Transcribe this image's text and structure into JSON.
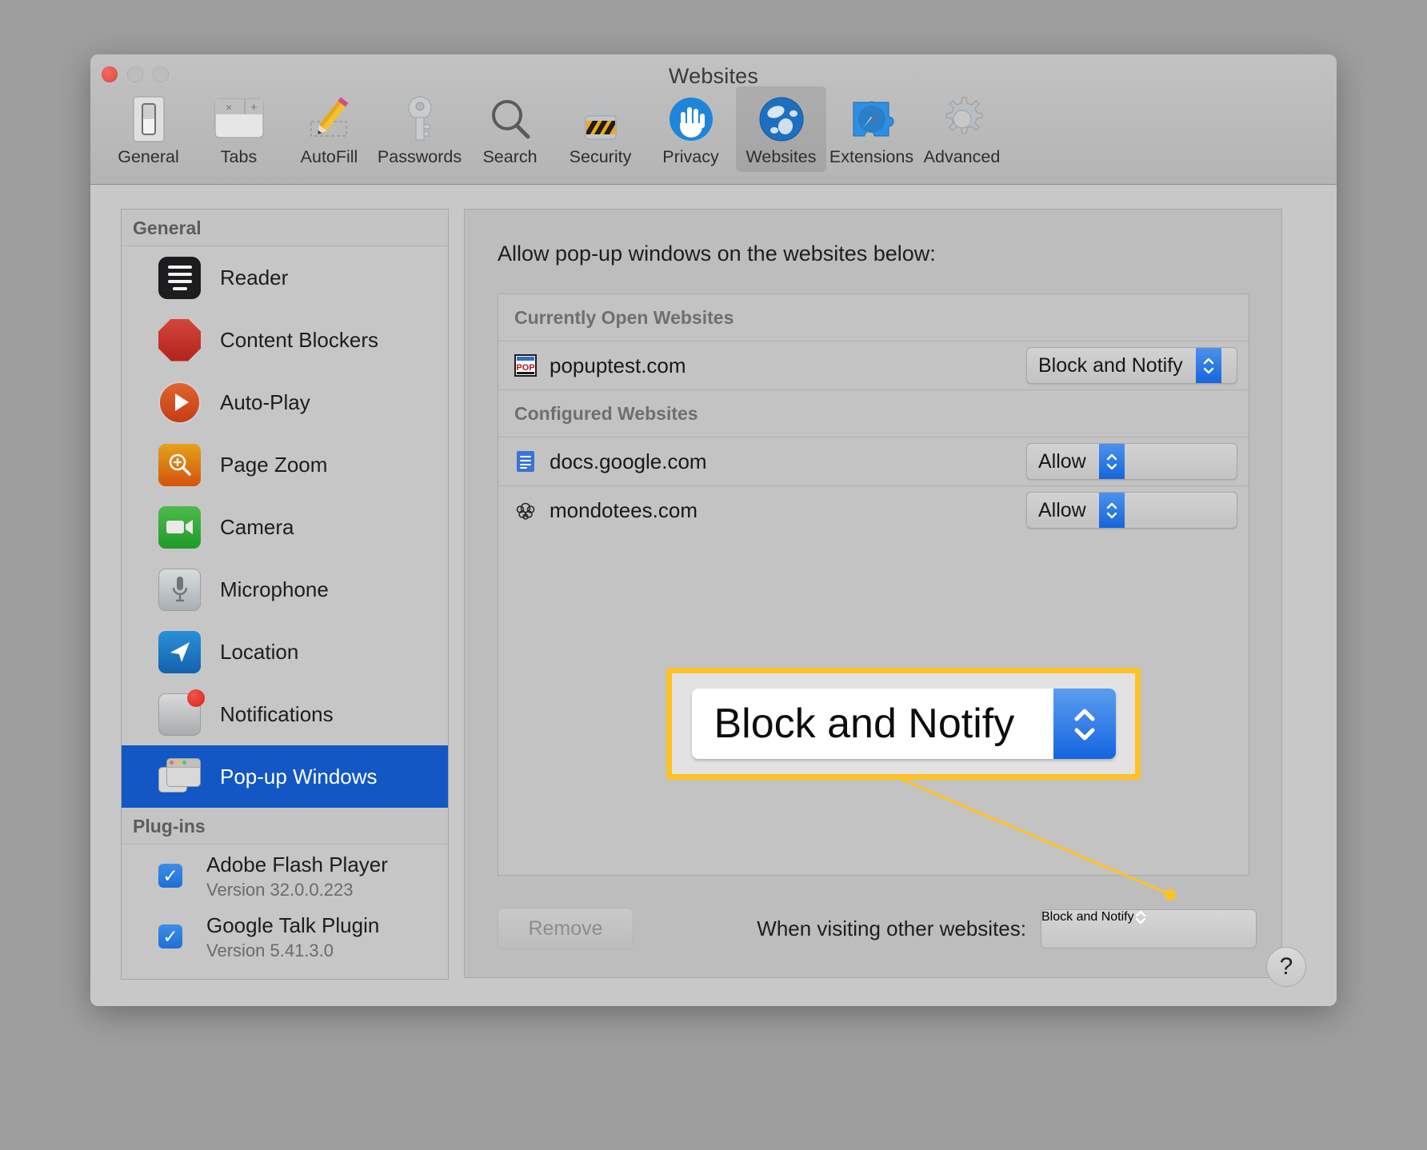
{
  "window": {
    "title": "Websites",
    "traffic_lights": [
      "close",
      "minimize",
      "zoom"
    ]
  },
  "toolbar": {
    "tabs": [
      {
        "label": "General",
        "icon": "switch-icon",
        "selected": false
      },
      {
        "label": "Tabs",
        "icon": "tabs-icon",
        "selected": false
      },
      {
        "label": "AutoFill",
        "icon": "pencil-icon",
        "selected": false
      },
      {
        "label": "Passwords",
        "icon": "key-icon",
        "selected": false
      },
      {
        "label": "Search",
        "icon": "magnifier-icon",
        "selected": false
      },
      {
        "label": "Security",
        "icon": "padlock-icon",
        "selected": false
      },
      {
        "label": "Privacy",
        "icon": "hand-icon",
        "selected": false
      },
      {
        "label": "Websites",
        "icon": "globe-icon",
        "selected": true
      },
      {
        "label": "Extensions",
        "icon": "puzzle-icon",
        "selected": false
      },
      {
        "label": "Advanced",
        "icon": "gear-icon",
        "selected": false
      }
    ]
  },
  "sidebar": {
    "general_header": "General",
    "plugins_header": "Plug-ins",
    "items": [
      {
        "label": "Reader",
        "icon": "reader-icon",
        "selected": false
      },
      {
        "label": "Content Blockers",
        "icon": "stop-sign-icon",
        "selected": false
      },
      {
        "label": "Auto-Play",
        "icon": "play-circle-icon",
        "selected": false
      },
      {
        "label": "Page Zoom",
        "icon": "zoom-in-icon",
        "selected": false
      },
      {
        "label": "Camera",
        "icon": "camera-icon",
        "selected": false
      },
      {
        "label": "Microphone",
        "icon": "microphone-icon",
        "selected": false
      },
      {
        "label": "Location",
        "icon": "location-arrow-icon",
        "selected": false
      },
      {
        "label": "Notifications",
        "icon": "notification-icon",
        "selected": false
      },
      {
        "label": "Pop-up Windows",
        "icon": "popup-windows-icon",
        "selected": true
      }
    ],
    "plugins": [
      {
        "name": "Adobe Flash Player",
        "version": "Version 32.0.0.223",
        "checked": true
      },
      {
        "name": "Google Talk Plugin",
        "version": "Version 5.41.3.0",
        "checked": true
      }
    ]
  },
  "main": {
    "caption": "Allow pop-up windows on the websites below:",
    "sections": [
      {
        "header": "Currently Open Websites",
        "rows": [
          {
            "site": "popuptest.com",
            "favicon": "popuptest-favicon",
            "value": "Block and Notify"
          }
        ]
      },
      {
        "header": "Configured Websites",
        "rows": [
          {
            "site": "docs.google.com",
            "favicon": "google-docs-favicon",
            "value": "Allow"
          },
          {
            "site": "mondotees.com",
            "favicon": "mondotees-favicon",
            "value": "Allow"
          }
        ]
      }
    ],
    "remove_label": "Remove",
    "visiting_label": "When visiting other websites:",
    "visiting_value": "Block and Notify",
    "help_label": "?"
  },
  "callout": {
    "value": "Block and Notify",
    "highlight_color": "#ffc226"
  }
}
